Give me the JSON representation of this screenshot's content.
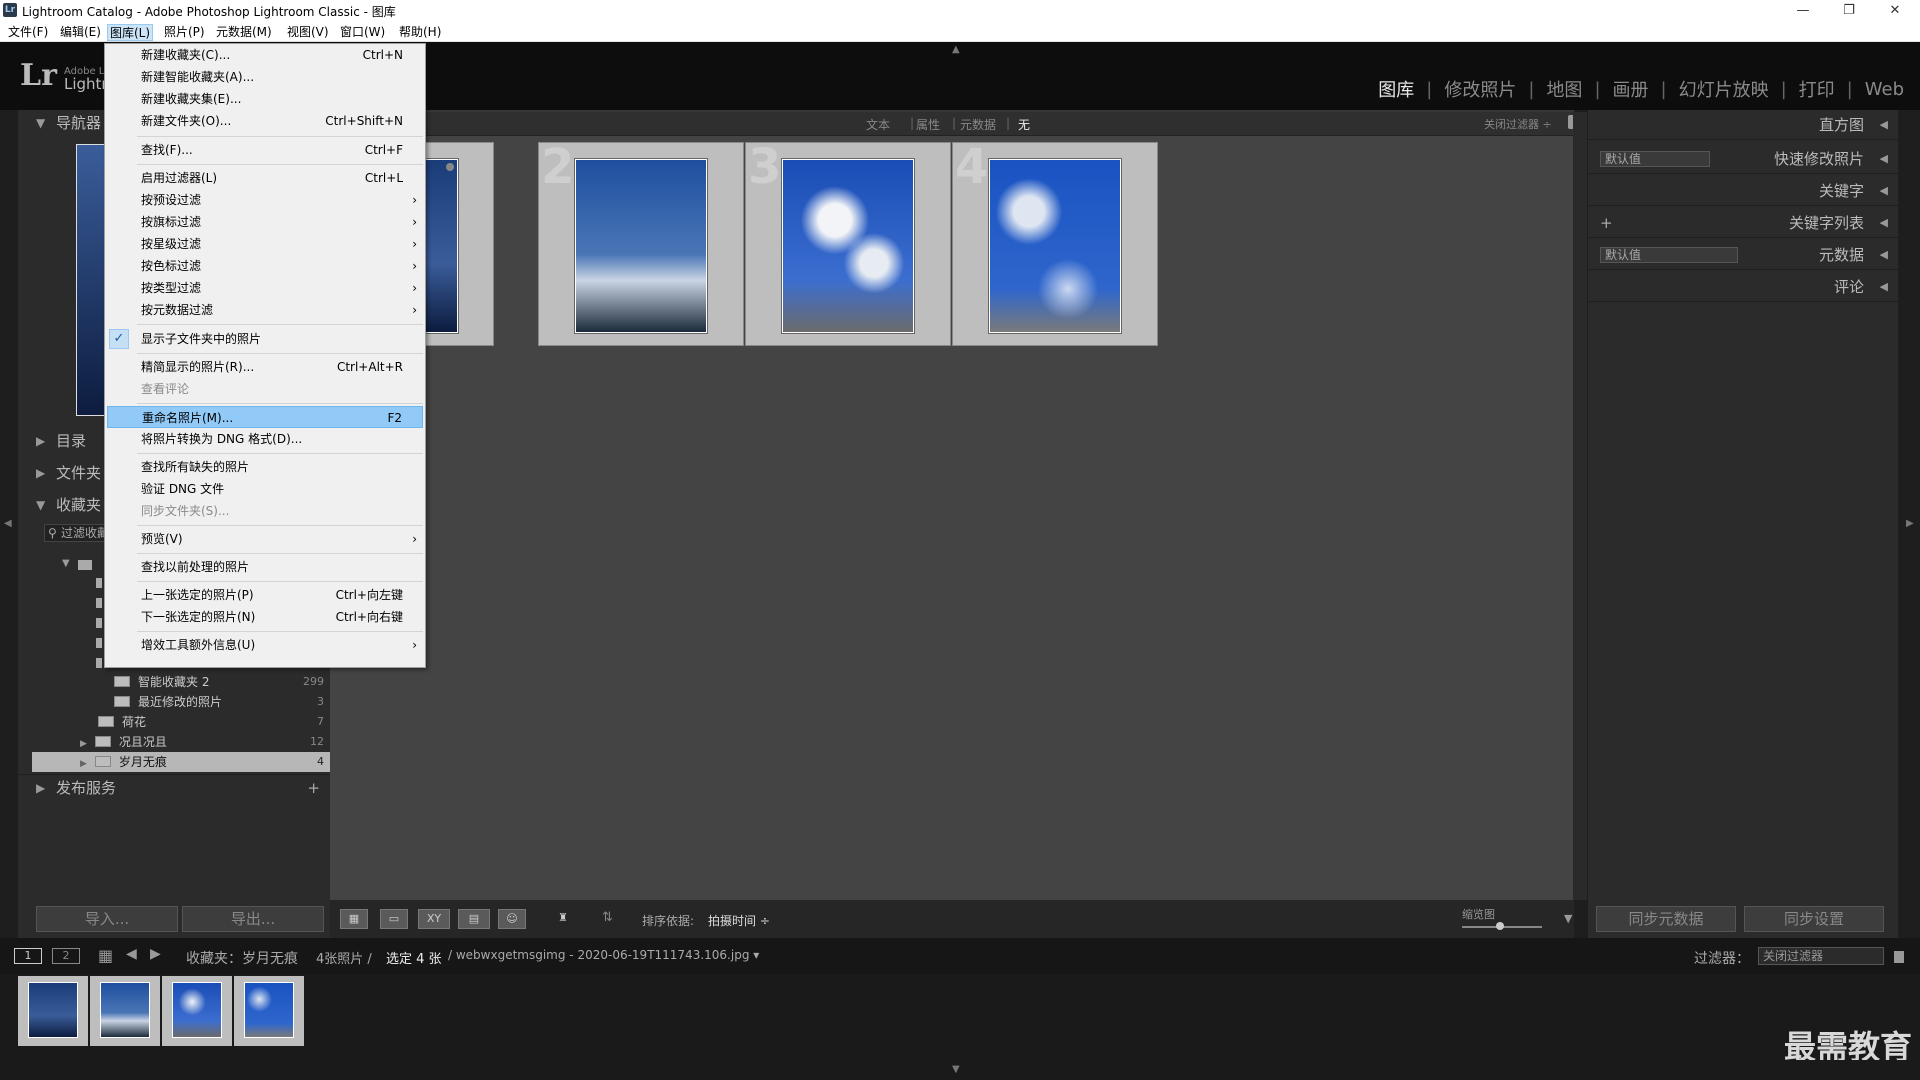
{
  "window": {
    "title": "Lightroom Catalog - Adobe Photoshop Lightroom Classic - 图库",
    "app_icon": "Lr",
    "controls": [
      "minimize-icon",
      "restore-icon",
      "close-icon"
    ]
  },
  "menubar": [
    {
      "label": "文件(F)",
      "active": false
    },
    {
      "label": "编辑(E)",
      "active": false
    },
    {
      "label": "图库(L)",
      "active": true
    },
    {
      "label": "照片(P)",
      "active": false
    },
    {
      "label": "元数据(M)",
      "active": false
    },
    {
      "label": "视图(V)",
      "active": false
    },
    {
      "label": "窗口(W)",
      "active": false
    },
    {
      "label": "帮助(H)",
      "active": false
    }
  ],
  "identity": {
    "logo": "Lr",
    "line1": "Adobe Li",
    "line2": "Lightr"
  },
  "modules": [
    {
      "label": "图库",
      "active": true
    },
    {
      "label": "修改照片",
      "active": false
    },
    {
      "label": "地图",
      "active": false
    },
    {
      "label": "画册",
      "active": false
    },
    {
      "label": "幻灯片放映",
      "active": false
    },
    {
      "label": "打印",
      "active": false
    },
    {
      "label": "Web",
      "active": false
    }
  ],
  "left_panel": {
    "navigator": "导航器",
    "catalog": "目录",
    "folders": "文件夹",
    "collections": "收藏夹",
    "filter_placeholder": "过滤收藏夹",
    "collection_items": [
      {
        "name": "智能收藏夹 2",
        "count": "299"
      },
      {
        "name": "最近修改的照片",
        "count": "3"
      },
      {
        "name": "荷花",
        "count": "7"
      },
      {
        "name": "况且况且",
        "count": "12"
      },
      {
        "name": "岁月无痕",
        "count": "4",
        "selected": true
      }
    ],
    "publish": "发布服务",
    "import_btn": "导入...",
    "export_btn": "导出..."
  },
  "filter_bar": {
    "tabs": [
      "文本",
      "属性",
      "元数据",
      "无"
    ],
    "active_tab": "无",
    "filter_preset": "关闭过滤器",
    "lock_icon": "lock-icon"
  },
  "grid": {
    "cells": [
      {
        "num": "",
        "colors": [
          "#3a5d9a",
          "#0d1c3f"
        ]
      },
      {
        "num": "2",
        "colors": [
          "#1e4f9f",
          "#c9d4e4"
        ]
      },
      {
        "num": "3",
        "colors": [
          "#1a4db5",
          "#f2f4f7"
        ]
      },
      {
        "num": "4",
        "colors": [
          "#1a53c2",
          "#cdd9f0"
        ]
      }
    ]
  },
  "right_panel": {
    "histogram": "直方图",
    "quick_develop": "快速修改照片",
    "quick_develop_preset": "默认值",
    "keywords": "关键字",
    "keyword_list": "关键字列表",
    "metadata": "元数据",
    "metadata_preset": "默认值",
    "comments": "评论",
    "sync_metadata": "同步元数据",
    "sync_settings": "同步设置"
  },
  "toolbar": {
    "sort_label": "排序依据:",
    "sort_value": "拍摄时间",
    "thumbnail_label": "缩览图"
  },
  "filmbar": {
    "page1": "1",
    "page2": "2",
    "source": "收藏夹：岁月无痕",
    "count_text": "4张照片 /",
    "selected_text": "选定 4 张",
    "filename": "/ webwxgetmsgimg - 2020-06-19T111743.106.jpg",
    "filter_label": "过滤器：",
    "filter_value": "关闭过滤器"
  },
  "watermark": "最需教育",
  "library_menu": [
    {
      "label": "新建收藏夹(C)...",
      "shortcut": "Ctrl+N"
    },
    {
      "label": "新建智能收藏夹(A)...",
      "shortcut": ""
    },
    {
      "label": "新建收藏夹集(E)...",
      "shortcut": ""
    },
    {
      "label": "新建文件夹(O)...",
      "shortcut": "Ctrl+Shift+N"
    },
    {
      "label": "查找(F)...",
      "shortcut": "Ctrl+F"
    },
    {
      "label": "启用过滤器(L)",
      "shortcut": "Ctrl+L"
    },
    {
      "label": "按预设过滤",
      "shortcut": ""
    },
    {
      "label": "按旗标过滤",
      "shortcut": ""
    },
    {
      "label": "按星级过滤",
      "shortcut": ""
    },
    {
      "label": "按色标过滤",
      "shortcut": ""
    },
    {
      "label": "按类型过滤",
      "shortcut": ""
    },
    {
      "label": "按元数据过滤",
      "shortcut": ""
    },
    {
      "label": "显示子文件夹中的照片",
      "shortcut": ""
    },
    {
      "label": "精简显示的照片(R)...",
      "shortcut": "Ctrl+Alt+R"
    },
    {
      "label": "查看评论",
      "shortcut": ""
    },
    {
      "label": "重命名照片(M)...",
      "shortcut": "F2"
    },
    {
      "label": "将照片转换为 DNG 格式(D)...",
      "shortcut": ""
    },
    {
      "label": "查找所有缺失的照片",
      "shortcut": ""
    },
    {
      "label": "验证 DNG 文件",
      "shortcut": ""
    },
    {
      "label": "同步文件夹(S)...",
      "shortcut": ""
    },
    {
      "label": "预览(V)",
      "shortcut": ""
    },
    {
      "label": "查找以前处理的照片",
      "shortcut": ""
    },
    {
      "label": "上一张选定的照片(P)",
      "shortcut": "Ctrl+向左键"
    },
    {
      "label": "下一张选定的照片(N)",
      "shortcut": "Ctrl+向右键"
    },
    {
      "label": "增效工具额外信息(U)",
      "shortcut": ""
    }
  ]
}
